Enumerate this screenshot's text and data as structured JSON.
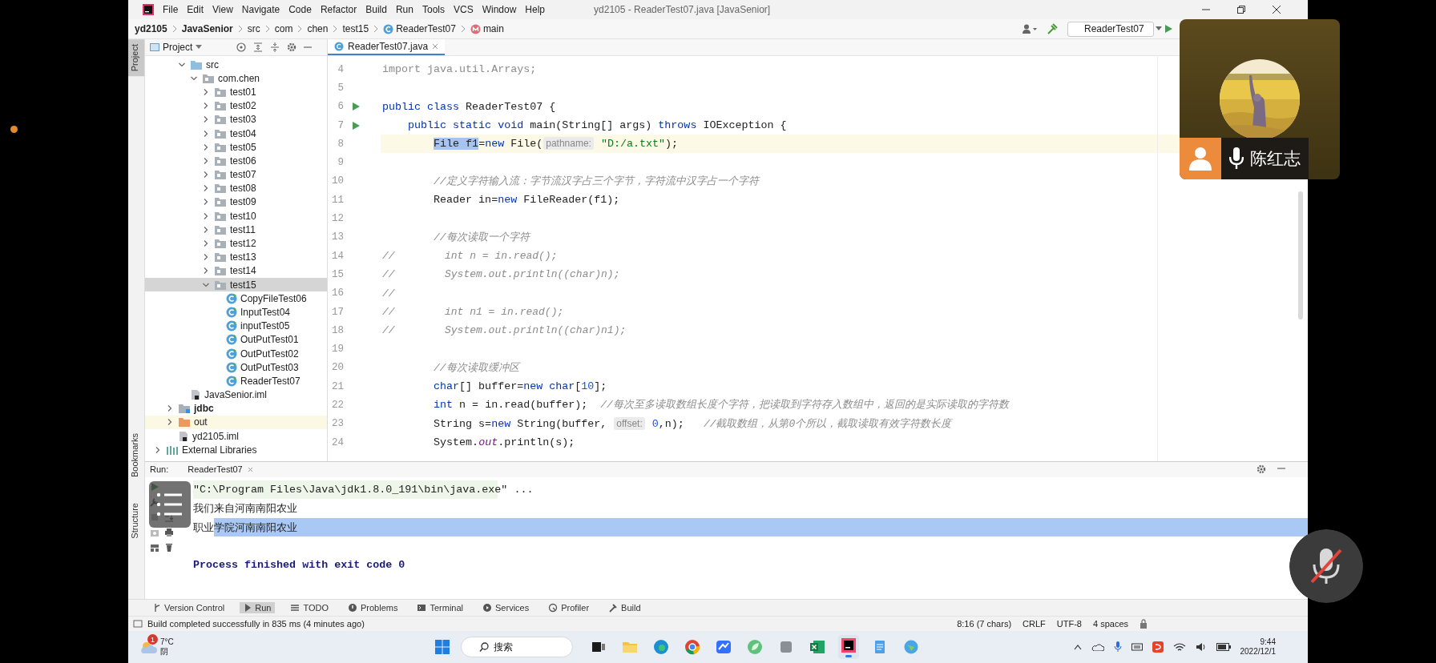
{
  "menu": [
    "File",
    "Edit",
    "View",
    "Navigate",
    "Code",
    "Refactor",
    "Build",
    "Run",
    "Tools",
    "VCS",
    "Window",
    "Help"
  ],
  "window": {
    "title": "yd2105 - ReaderTest07.java [JavaSenior]"
  },
  "breadcrumbs": [
    {
      "label": "yd2105",
      "kind": "project"
    },
    {
      "label": "JavaSenior",
      "kind": "module"
    },
    {
      "label": "src",
      "kind": "dir"
    },
    {
      "label": "com",
      "kind": "dir"
    },
    {
      "label": "chen",
      "kind": "dir"
    },
    {
      "label": "test15",
      "kind": "dir"
    },
    {
      "label": "ReaderTest07",
      "kind": "class"
    },
    {
      "label": "main",
      "kind": "method"
    }
  ],
  "run_config": {
    "label": "ReaderTest07"
  },
  "side_tools": [
    {
      "label": "Project",
      "selected": true
    },
    {
      "label": "Bookmarks",
      "selected": false
    },
    {
      "label": "Structure",
      "selected": false
    }
  ],
  "project_panel": {
    "title": "Project"
  },
  "project_tree": {
    "module_items": [
      {
        "label": "src",
        "kind": "source-folder",
        "selected": false,
        "expanded": true,
        "children": [
          {
            "label": "com.chen",
            "kind": "package",
            "selected": false,
            "expanded": true,
            "children": [
              {
                "label": "test01",
                "kind": "package",
                "selected": false,
                "expanded": false
              },
              {
                "label": "test02",
                "kind": "package",
                "selected": false,
                "expanded": false
              },
              {
                "label": "test03",
                "kind": "package",
                "selected": false,
                "expanded": false
              },
              {
                "label": "test04",
                "kind": "package",
                "selected": false,
                "expanded": false
              },
              {
                "label": "test05",
                "kind": "package",
                "selected": false,
                "expanded": false
              },
              {
                "label": "test06",
                "kind": "package",
                "selected": false,
                "expanded": false
              },
              {
                "label": "test07",
                "kind": "package",
                "selected": false,
                "expanded": false
              },
              {
                "label": "test08",
                "kind": "package",
                "selected": false,
                "expanded": false
              },
              {
                "label": "test09",
                "kind": "package",
                "selected": false,
                "expanded": false
              },
              {
                "label": "test10",
                "kind": "package",
                "selected": false,
                "expanded": false
              },
              {
                "label": "test11",
                "kind": "package",
                "selected": false,
                "expanded": false
              },
              {
                "label": "test12",
                "kind": "package",
                "selected": false,
                "expanded": false
              },
              {
                "label": "test13",
                "kind": "package",
                "selected": false,
                "expanded": false
              },
              {
                "label": "test14",
                "kind": "package",
                "selected": false,
                "expanded": false
              },
              {
                "label": "test15",
                "kind": "package",
                "selected": true,
                "expanded": true,
                "children": [
                  {
                    "label": "CopyFileTest06",
                    "kind": "class",
                    "selected": false
                  },
                  {
                    "label": "InputTest04",
                    "kind": "class",
                    "selected": false
                  },
                  {
                    "label": "inputTest05",
                    "kind": "class",
                    "selected": false
                  },
                  {
                    "label": "OutPutTest01",
                    "kind": "class",
                    "selected": false
                  },
                  {
                    "label": "OutPutTest02",
                    "kind": "class",
                    "selected": false
                  },
                  {
                    "label": "OutPutTest03",
                    "kind": "class",
                    "selected": false
                  },
                  {
                    "label": "ReaderTest07",
                    "kind": "class",
                    "selected": false
                  }
                ]
              }
            ]
          }
        ]
      },
      {
        "label": "JavaSenior.iml",
        "kind": "module-file",
        "selected": false
      }
    ],
    "project_items": [
      {
        "label": "jdbc",
        "kind": "module",
        "selected": false,
        "expanded": false
      },
      {
        "label": "out",
        "kind": "excluded-folder",
        "selected": false,
        "expanded": false
      },
      {
        "label": "yd2105.iml",
        "kind": "module-file",
        "selected": false
      }
    ],
    "root_items": [
      {
        "label": "External Libraries",
        "kind": "libraries",
        "selected": false,
        "expanded": false
      }
    ]
  },
  "editor_tabs": [
    {
      "label": "ReaderTest07.java",
      "selected": true
    }
  ],
  "code_lines": [
    {
      "number": "4",
      "runnable": false,
      "current": false,
      "segments": [
        {
          "kind": "unused",
          "text": "import java.util.Arrays;"
        }
      ]
    },
    {
      "number": "5",
      "runnable": false,
      "current": false
    },
    {
      "number": "6",
      "runnable": true,
      "current": false,
      "segments": [
        {
          "kind": "kw",
          "text": "public class"
        },
        {
          "kind": "plain",
          "text": " ReaderTest07 {"
        }
      ]
    },
    {
      "number": "7",
      "runnable": true,
      "current": false,
      "segments": [
        {
          "kind": "kw",
          "text": "    public static void"
        },
        {
          "kind": "plain",
          "text": " main(String[] args) "
        },
        {
          "kind": "kw",
          "text": "throws"
        },
        {
          "kind": "plain",
          "text": " IOException {"
        }
      ]
    },
    {
      "number": "8",
      "runnable": false,
      "current": true,
      "segments": [
        {
          "kind": "selection",
          "text": "        File f1"
        },
        {
          "kind": "plain",
          "text": "="
        },
        {
          "kind": "kw",
          "text": "new"
        },
        {
          "kind": "plain",
          "text": " File("
        },
        {
          "kind": "hint",
          "text": "pathname:"
        },
        {
          "kind": "str",
          "text": " \"D:/a.txt\""
        },
        {
          "kind": "plain",
          "text": ");"
        }
      ]
    },
    {
      "number": "9",
      "runnable": false,
      "current": false
    },
    {
      "number": "10",
      "runnable": false,
      "current": false,
      "segments": [
        {
          "kind": "comment",
          "text": "        //定义字符输入流：字节流汉字占三个字节，字符流中汉字占一个字符"
        }
      ]
    },
    {
      "number": "11",
      "runnable": false,
      "current": false,
      "segments": [
        {
          "kind": "plain",
          "text": "        Reader in="
        },
        {
          "kind": "kw",
          "text": "new"
        },
        {
          "kind": "plain",
          "text": " FileReader(f1);"
        }
      ]
    },
    {
      "number": "12",
      "runnable": false,
      "current": false
    },
    {
      "number": "13",
      "runnable": false,
      "current": false,
      "segments": [
        {
          "kind": "comment",
          "text": "        //每次读取一个字符"
        }
      ]
    },
    {
      "number": "14",
      "runnable": false,
      "current": false,
      "segments": [
        {
          "kind": "comment",
          "text": "//        int n = in.read();"
        }
      ]
    },
    {
      "number": "15",
      "runnable": false,
      "current": false,
      "segments": [
        {
          "kind": "comment",
          "text": "//        System.out.println((char)n);"
        }
      ]
    },
    {
      "number": "16",
      "runnable": false,
      "current": false,
      "segments": [
        {
          "kind": "comment",
          "text": "//"
        }
      ]
    },
    {
      "number": "17",
      "runnable": false,
      "current": false,
      "segments": [
        {
          "kind": "comment",
          "text": "//        int n1 = in.read();"
        }
      ]
    },
    {
      "number": "18",
      "runnable": false,
      "current": false,
      "segments": [
        {
          "kind": "comment",
          "text": "//        System.out.println((char)n1);"
        }
      ]
    },
    {
      "number": "19",
      "runnable": false,
      "current": false
    },
    {
      "number": "20",
      "runnable": false,
      "current": false,
      "segments": [
        {
          "kind": "comment",
          "text": "        //每次读取缓冲区"
        }
      ]
    },
    {
      "number": "21",
      "runnable": false,
      "current": false,
      "segments": [
        {
          "kind": "kw",
          "text": "        char"
        },
        {
          "kind": "plain",
          "text": "[] buffer="
        },
        {
          "kind": "kw",
          "text": "new"
        },
        {
          "kind": "kw",
          "text": " char"
        },
        {
          "kind": "plain",
          "text": "["
        },
        {
          "kind": "num",
          "text": "10"
        },
        {
          "kind": "plain",
          "text": "];"
        }
      ]
    },
    {
      "number": "22",
      "runnable": false,
      "current": false,
      "segments": [
        {
          "kind": "kw",
          "text": "        int"
        },
        {
          "kind": "plain",
          "text": " n = in.read(buffer);  "
        },
        {
          "kind": "comment",
          "text": "//每次至多读取数组长度个字符，把读取到字符存入数组中，返回的是实际读取的字符数"
        }
      ]
    },
    {
      "number": "23",
      "runnable": false,
      "current": false,
      "segments": [
        {
          "kind": "plain",
          "text": "        String s="
        },
        {
          "kind": "kw",
          "text": "new"
        },
        {
          "kind": "plain",
          "text": " String(buffer, "
        },
        {
          "kind": "hint",
          "text": "offset:"
        },
        {
          "kind": "num",
          "text": " 0"
        },
        {
          "kind": "plain",
          "text": ",n);   "
        },
        {
          "kind": "comment",
          "text": "//截取数组，从第0个所以，截取读取有效字符数长度"
        }
      ]
    },
    {
      "number": "24",
      "runnable": false,
      "current": false,
      "segments": [
        {
          "kind": "plain",
          "text": "        System."
        },
        {
          "kind": "field",
          "text": "out"
        },
        {
          "kind": "plain",
          "text": ".println(s);"
        }
      ]
    }
  ],
  "run_panel": {
    "title": "Run:",
    "tab": "ReaderTest07",
    "output": [
      {
        "kind": "command",
        "segments": [
          {
            "text": "\"C:\\Program Files\\Java\\jdk1.8.0_191\\bin\\java.exe\" ...",
            "selected": false
          }
        ]
      },
      {
        "kind": "output",
        "segments": [
          {
            "text": "我们来自河南南阳农业",
            "selected": false
          }
        ]
      },
      {
        "kind": "output",
        "segments": [
          {
            "text": "职业",
            "selected": false
          },
          {
            "text": "学院河南南阳农业",
            "selected": true
          }
        ]
      },
      {
        "kind": "process",
        "segments": [
          {
            "text": "Process finished with exit code 0",
            "selected": false
          }
        ]
      }
    ]
  },
  "tool_windows": [
    {
      "label": "Version Control",
      "kind": "vcs",
      "selected": false
    },
    {
      "label": "Run",
      "kind": "run",
      "selected": true
    },
    {
      "label": "TODO",
      "kind": "todo",
      "selected": false
    },
    {
      "label": "Problems",
      "kind": "problems",
      "selected": false
    },
    {
      "label": "Terminal",
      "kind": "terminal",
      "selected": false
    },
    {
      "label": "Services",
      "kind": "services",
      "selected": false
    },
    {
      "label": "Profiler",
      "kind": "profiler",
      "selected": false
    },
    {
      "label": "Build",
      "kind": "build",
      "selected": false
    }
  ],
  "status": {
    "message": "Build completed successfully in 835 ms (4 minutes ago)",
    "position": "8:16 (7 chars)",
    "line_ending": "CRLF",
    "encoding": "UTF-8",
    "indent": "4 spaces"
  },
  "call_card": {
    "name": "陈红志"
  },
  "taskbar": {
    "badge": "1",
    "temperature": "7°C",
    "weather": "阴",
    "search": "搜索",
    "time": "9:44",
    "date": "2022/12/1",
    "apps": [
      {
        "kind": "taskview",
        "selected": false
      },
      {
        "kind": "folder",
        "selected": false
      },
      {
        "kind": "edge",
        "selected": false
      },
      {
        "kind": "chrome",
        "selected": false
      },
      {
        "kind": "feishu",
        "selected": false
      },
      {
        "kind": "green",
        "selected": false
      },
      {
        "kind": "grey",
        "selected": false
      },
      {
        "kind": "excel",
        "selected": false
      },
      {
        "kind": "intellij",
        "selected": true
      },
      {
        "kind": "notepad",
        "selected": false
      },
      {
        "kind": "globe",
        "selected": false
      }
    ]
  }
}
